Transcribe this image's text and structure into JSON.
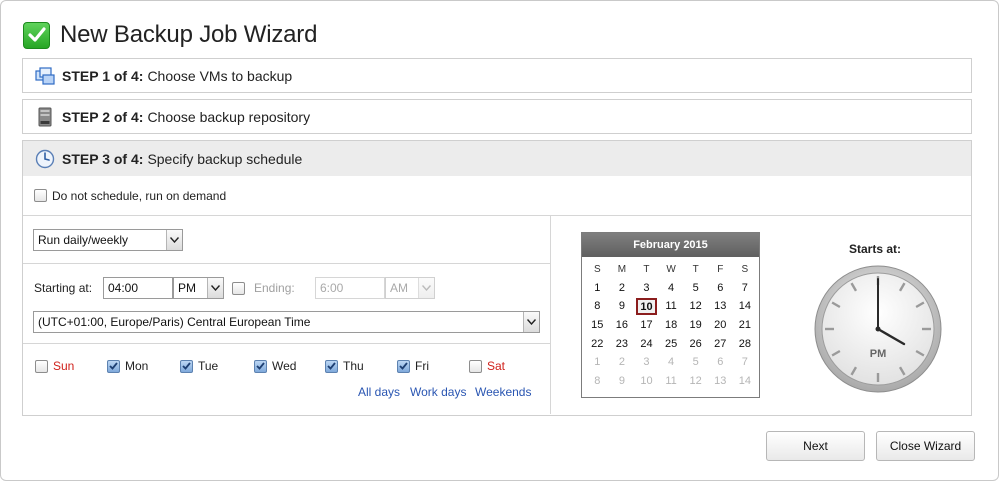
{
  "title": "New Backup Job Wizard",
  "steps": [
    {
      "prefix": "STEP 1 of 4:",
      "text": "Choose VMs to backup",
      "icon": "vms-icon"
    },
    {
      "prefix": "STEP 2 of 4:",
      "text": "Choose backup repository",
      "icon": "repository-icon"
    },
    {
      "prefix": "STEP 3 of 4:",
      "text": "Specify backup schedule",
      "icon": "clock-icon"
    }
  ],
  "schedule": {
    "on_demand_label": "Do not schedule, run on demand",
    "on_demand_checked": false,
    "frequency": "Run daily/weekly",
    "starting_label": "Starting at:",
    "start_time": "04:00",
    "start_ampm": "PM",
    "ending_label": "Ending:",
    "ending_checked": false,
    "end_time": "6:00",
    "end_ampm": "AM",
    "timezone": "(UTC+01:00, Europe/Paris) Central European Time",
    "days": [
      {
        "label": "Sun",
        "checked": false,
        "weekend": true
      },
      {
        "label": "Mon",
        "checked": true,
        "weekend": false
      },
      {
        "label": "Tue",
        "checked": true,
        "weekend": false
      },
      {
        "label": "Wed",
        "checked": true,
        "weekend": false
      },
      {
        "label": "Thu",
        "checked": true,
        "weekend": false
      },
      {
        "label": "Fri",
        "checked": true,
        "weekend": false
      },
      {
        "label": "Sat",
        "checked": false,
        "weekend": true
      }
    ],
    "links": {
      "all": "All days",
      "work": "Work days",
      "weekends": "Weekends"
    }
  },
  "calendar": {
    "month": "February 2015",
    "weekdays": [
      "S",
      "M",
      "T",
      "W",
      "T",
      "F",
      "S"
    ],
    "today": 10,
    "weeks": [
      [
        "1",
        "2",
        "3",
        "4",
        "5",
        "6",
        "7"
      ],
      [
        "8",
        "9",
        "10",
        "11",
        "12",
        "13",
        "14"
      ],
      [
        "15",
        "16",
        "17",
        "18",
        "19",
        "20",
        "21"
      ],
      [
        "22",
        "23",
        "24",
        "25",
        "26",
        "27",
        "28"
      ],
      [
        "1",
        "2",
        "3",
        "4",
        "5",
        "6",
        "7"
      ],
      [
        "8",
        "9",
        "10",
        "11",
        "12",
        "13",
        "14"
      ]
    ],
    "other_month_rows": [
      4,
      5
    ]
  },
  "clock": {
    "label": "Starts at:",
    "meridiem": "PM",
    "hour": 4,
    "minute": 0
  },
  "buttons": {
    "next": "Next",
    "close": "Close Wizard"
  },
  "colors": {
    "link": "#2a56b2",
    "weekend": "#d0211b",
    "accent": "#2fa52b"
  }
}
